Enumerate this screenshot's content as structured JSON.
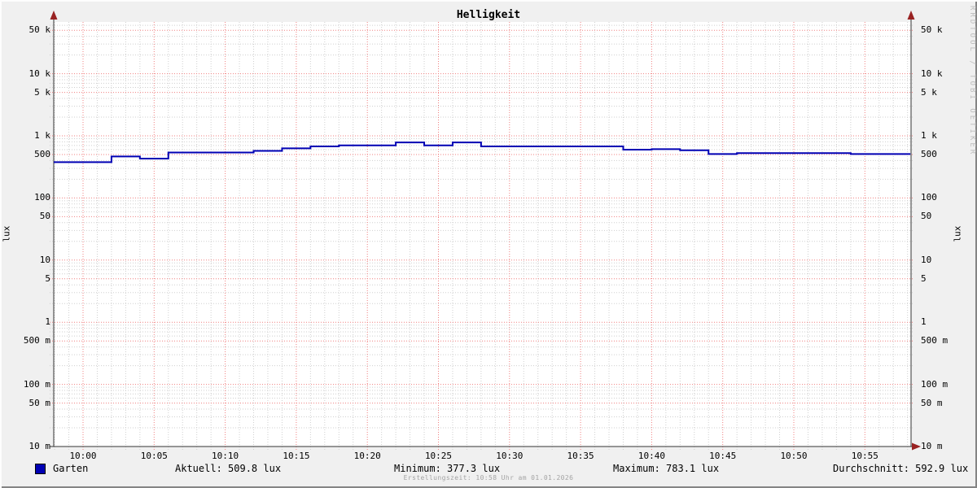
{
  "title": "Helligkeit",
  "y_axis_unit": "lux",
  "watermark": "RRDTOOL / TOBI OETIKER",
  "footer": "Erstellungszeit: 10:58 Uhr am 01.01.2026",
  "legend": {
    "series_label": "Garten",
    "swatch_color": "#0000b4"
  },
  "stats": {
    "current_label": "Aktuell: 509.8 lux",
    "min_label": "Minimum: 377.3 lux",
    "max_label": "Maximum: 783.1 lux",
    "avg_label": "Durchschnitt: 592.9 lux"
  },
  "chart_data": {
    "type": "line",
    "line_style": "step-after",
    "title": "Helligkeit",
    "ylabel": "lux",
    "y_scale": "log",
    "ylim": [
      0.01,
      68000
    ],
    "x_axis_minutes_from_10_00": [
      -2.3,
      58.2
    ],
    "grid": {
      "major_color": "#f08080",
      "minor_color": "#cfcfcf",
      "shown": true
    },
    "axis_color": "#333333",
    "arrow_color": "#992222",
    "plot_bg": "#ffffff",
    "series": [
      {
        "name": "Garten",
        "color": "#0000b4",
        "points_t_min_lux": [
          [
            -2.3,
            377.3
          ],
          [
            2,
            465
          ],
          [
            4,
            430
          ],
          [
            6,
            540
          ],
          [
            12,
            572
          ],
          [
            14,
            630
          ],
          [
            16,
            676
          ],
          [
            18,
            703
          ],
          [
            22,
            783.1
          ],
          [
            24,
            703
          ],
          [
            26,
            783.1
          ],
          [
            28,
            676
          ],
          [
            38,
            598
          ],
          [
            40,
            610
          ],
          [
            42,
            585
          ],
          [
            44,
            510
          ],
          [
            46,
            527
          ],
          [
            54,
            509.8
          ]
        ],
        "end_t_min": 58.2
      }
    ],
    "stats": {
      "current": 509.8,
      "minimum": 377.3,
      "maximum": 783.1,
      "average": 592.9
    },
    "x_ticks": [
      {
        "t": 0,
        "label": "10:00"
      },
      {
        "t": 5,
        "label": "10:05"
      },
      {
        "t": 10,
        "label": "10:10"
      },
      {
        "t": 15,
        "label": "10:15"
      },
      {
        "t": 20,
        "label": "10:20"
      },
      {
        "t": 25,
        "label": "10:25"
      },
      {
        "t": 30,
        "label": "10:30"
      },
      {
        "t": 35,
        "label": "10:35"
      },
      {
        "t": 40,
        "label": "10:40"
      },
      {
        "t": 45,
        "label": "10:45"
      },
      {
        "t": 50,
        "label": "10:50"
      },
      {
        "t": 55,
        "label": "10:55"
      }
    ],
    "y_ticks": [
      {
        "v": 50000,
        "label": "50 k"
      },
      {
        "v": 10000,
        "label": "10 k"
      },
      {
        "v": 5000,
        "label": "5 k"
      },
      {
        "v": 1000,
        "label": "1 k"
      },
      {
        "v": 500,
        "label": "500"
      },
      {
        "v": 100,
        "label": "100"
      },
      {
        "v": 50,
        "label": "50"
      },
      {
        "v": 10,
        "label": "10"
      },
      {
        "v": 5,
        "label": "5"
      },
      {
        "v": 1,
        "label": "1"
      },
      {
        "v": 0.5,
        "label": "500 m"
      },
      {
        "v": 0.1,
        "label": "100 m"
      },
      {
        "v": 0.05,
        "label": "50 m"
      },
      {
        "v": 0.01,
        "label": "10 m"
      }
    ],
    "legend_position": "bottom-left"
  }
}
